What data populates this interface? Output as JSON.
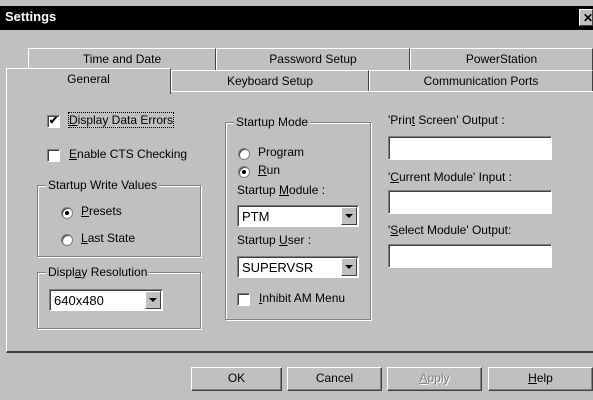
{
  "window": {
    "title": "Settings",
    "close_glyph": "✕"
  },
  "tabs_row1": [
    {
      "label": "Time and Date"
    },
    {
      "label": "Password Setup"
    },
    {
      "label": "PowerStation"
    }
  ],
  "tabs_row2": [
    {
      "label": "General",
      "active": true
    },
    {
      "label": "Keyboard Setup"
    },
    {
      "label": "Communication Ports"
    }
  ],
  "general": {
    "display_data_errors": {
      "label_u": "D",
      "label_rest": "isplay Data Errors",
      "checked": true
    },
    "enable_cts": {
      "label_u": "E",
      "label_rest": "nable CTS Checking",
      "checked": false
    },
    "startup_write_values": {
      "title": "Startup Write Values",
      "options": [
        {
          "label_u": "P",
          "label_rest": "resets",
          "selected": true
        },
        {
          "label_u": "L",
          "label_rest": "ast State",
          "selected": false
        }
      ]
    },
    "display_resolution": {
      "title_pre": "Displ",
      "title_u": "a",
      "title_post": "y Resolution",
      "value": "640x480"
    },
    "startup_mode": {
      "title": "Startup Mode",
      "options": [
        {
          "label_pre": "",
          "label_u": "",
          "label_rest": "Program",
          "selected": false
        },
        {
          "label_pre": "",
          "label_u": "R",
          "label_rest": "un",
          "selected": true
        }
      ],
      "module_label_pre": "Startup ",
      "module_label_u": "M",
      "module_label_post": "odule :",
      "module_value": "PTM",
      "user_label_pre": "Startup ",
      "user_label_u": "U",
      "user_label_post": "ser :",
      "user_value": "SUPERVSR",
      "inhibit": {
        "label_u": "I",
        "label_rest": "nhibit AM Menu",
        "checked": false
      }
    },
    "outputs": {
      "print_screen_pre": "'Prin",
      "print_screen_u": "t",
      "print_screen_post": " Screen' Output :",
      "print_screen_value": "",
      "current_module_pre": "'",
      "current_module_u": "C",
      "current_module_post": "urrent Module' Input :",
      "current_module_value": "",
      "select_module_pre": "'",
      "select_module_u": "S",
      "select_module_post": "elect Module' Output:",
      "select_module_value": ""
    }
  },
  "buttons": {
    "ok": "OK",
    "cancel": "Cancel",
    "apply_u": "A",
    "apply_rest": "pply",
    "help_u": "H",
    "help_rest": "elp"
  }
}
